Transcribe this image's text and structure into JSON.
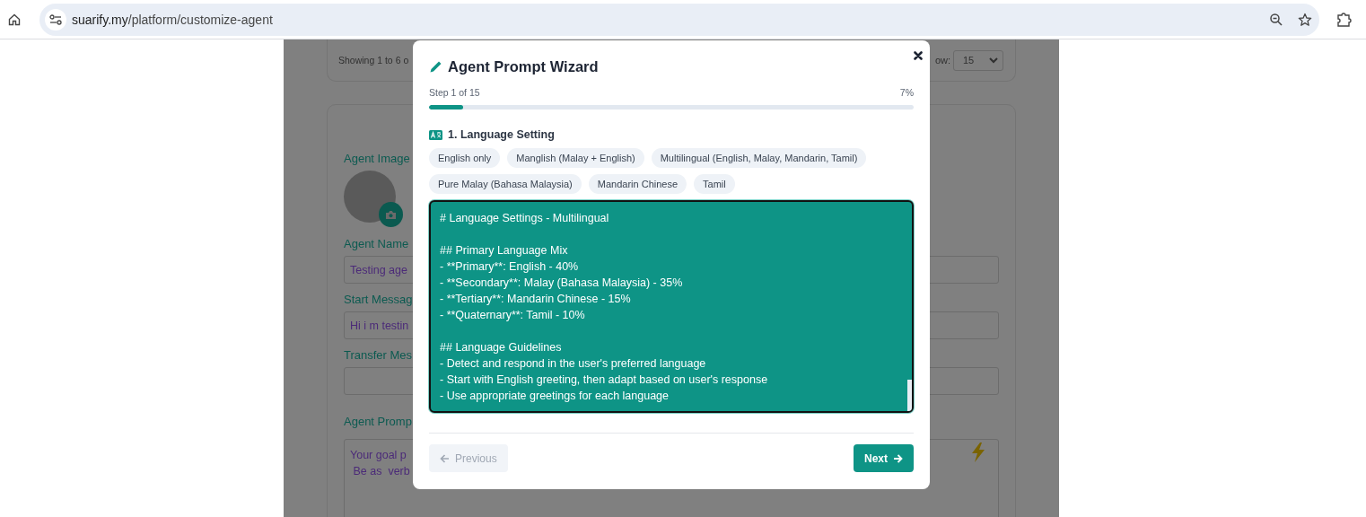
{
  "browser": {
    "url_host": "suarify.my",
    "url_path": "/platform/customize-agent"
  },
  "page": {
    "pagination": {
      "summary": "Showing 1 to 6 o",
      "show_label": "ow:",
      "page_size": "15"
    },
    "form": {
      "image_label": "Agent Image",
      "fields": [
        {
          "label": "Agent Name",
          "value": "Testing age"
        },
        {
          "label": "Start Messag",
          "value": "Hi i m testin"
        },
        {
          "label": "Transfer Mes"
        }
      ],
      "prompt": {
        "label": "Agent Promp",
        "lines": [
          "Your goal p",
          " Be as  verb"
        ]
      }
    }
  },
  "wizard": {
    "title": "Agent Prompt Wizard",
    "step": "Step 1 of 15",
    "percent": "7%",
    "progress": {
      "level": 0.07
    },
    "section": "1. Language Setting",
    "options": [
      "English only",
      "Manglish (Malay + English)",
      "Multilingual (English, Malay, Mandarin, Tamil)",
      "Pure Malay (Bahasa Malaysia)",
      "Mandarin Chinese",
      "Tamil"
    ],
    "editor_blocks": [
      [
        "# Language Settings - Multilingual"
      ],
      [
        "## Primary Language Mix",
        "- **Primary**: English - 40%",
        "- **Secondary**: Malay (Bahasa Malaysia) - 35%",
        "- **Tertiary**: Mandarin Chinese - 15%",
        "- **Quaternary**: Tamil - 10%"
      ],
      [
        "## Language Guidelines",
        "- Detect and respond in the user's preferred language",
        "- Start with English greeting, then adapt based on user's response",
        "- Use appropriate greetings for each language"
      ]
    ],
    "buttons": [
      {
        "label": "Previous",
        "kind": "previous",
        "disabled": true
      },
      {
        "label": "Next",
        "kind": "next",
        "disabled": false
      }
    ]
  }
}
